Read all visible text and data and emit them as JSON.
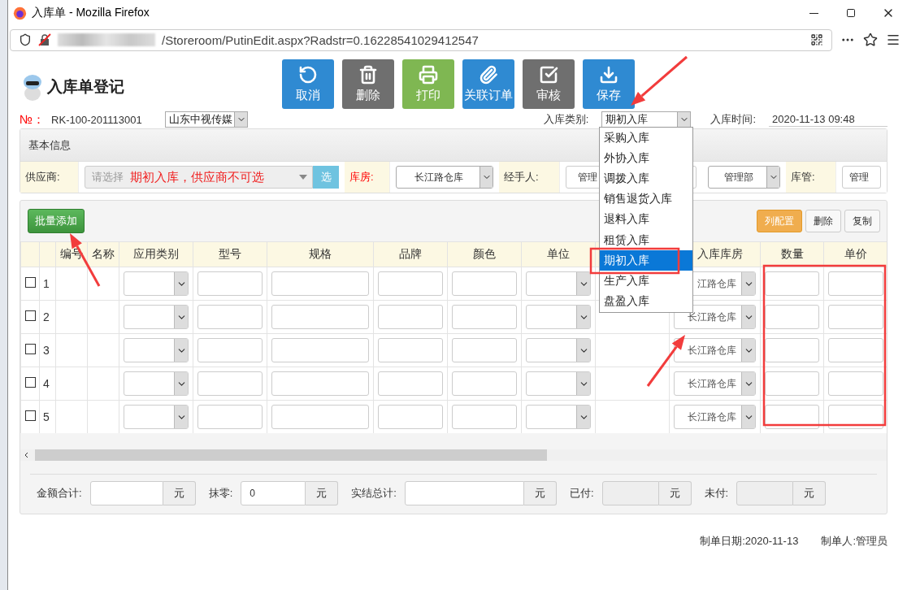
{
  "window": {
    "title": "入库单 - Mozilla Firefox"
  },
  "address_bar": {
    "url": "/Storeroom/PutinEdit.aspx?Radstr=0.16228541029412547"
  },
  "page": {
    "title": "入库单登记"
  },
  "toolbar": [
    {
      "label": "取消",
      "kind": "undo",
      "color": "#2f8ad2"
    },
    {
      "label": "删除",
      "kind": "trash",
      "color": "#6f6f6f"
    },
    {
      "label": "打印",
      "kind": "print",
      "color": "#7fb752"
    },
    {
      "label": "关联订单",
      "kind": "clip",
      "color": "#2f8ad2"
    },
    {
      "label": "审核",
      "kind": "check",
      "color": "#6f6f6f"
    },
    {
      "label": "保存",
      "kind": "download",
      "color": "#2f8ad2"
    }
  ],
  "order": {
    "no_label": "№：",
    "no": "RK-100-201113001",
    "company": "山东中视传媒",
    "type_label": "入库类别:",
    "type_value": "期初入库",
    "time_label": "入库时间:",
    "time_value": "2020-11-13 09:48"
  },
  "type_dropdown": [
    {
      "label": "采购入库",
      "selected": false
    },
    {
      "label": "外协入库",
      "selected": false
    },
    {
      "label": "调拨入库",
      "selected": false
    },
    {
      "label": "销售退货入库",
      "selected": false
    },
    {
      "label": "退料入库",
      "selected": false
    },
    {
      "label": "租赁入库",
      "selected": false
    },
    {
      "label": "期初入库",
      "selected": true
    },
    {
      "label": "生产入库",
      "selected": false
    },
    {
      "label": "盘盈入库",
      "selected": false
    }
  ],
  "basic_info": {
    "title": "基本信息",
    "supplier_label": "供应商:",
    "supplier_placeholder": "请选择",
    "supplier_disabled": true,
    "supplier_note": "期初入库，供应商不可选",
    "pick_button": "选",
    "warehouse_label": "库房:",
    "warehouse": "长江路仓库",
    "handler_label": "经手人:",
    "handler": "管理",
    "department": "管理部",
    "keeper_label": "库管:",
    "keeper": "管理"
  },
  "table_toolbar": {
    "add_button": "批量添加",
    "right_buttons": [
      {
        "label": "列配置",
        "kind": "primary"
      },
      {
        "label": "删除",
        "kind": "default"
      },
      {
        "label": "复制",
        "kind": "default"
      }
    ]
  },
  "table": {
    "columns": [
      {
        "kind": "check"
      },
      {
        "kind": "index"
      },
      {
        "label": "编号",
        "kind": "text"
      },
      {
        "label": "名称",
        "kind": "text"
      },
      {
        "label": "应用类别",
        "kind": "select"
      },
      {
        "label": "型号",
        "kind": "input"
      },
      {
        "label": "规格",
        "kind": "input"
      },
      {
        "label": "品牌",
        "kind": "input"
      },
      {
        "label": "颜色",
        "kind": "input"
      },
      {
        "label": "单位",
        "kind": "select"
      },
      {
        "kind": "blank"
      },
      {
        "label": "入库库房",
        "kind": "warehouse"
      },
      {
        "label": "数量",
        "kind": "input"
      },
      {
        "label": "单价",
        "kind": "input"
      }
    ],
    "rows": [
      {
        "index": "1",
        "checked": false,
        "warehouse": "江路仓库"
      },
      {
        "index": "2",
        "checked": false,
        "warehouse": "长江路仓库"
      },
      {
        "index": "3",
        "checked": false,
        "warehouse": "长江路仓库"
      },
      {
        "index": "4",
        "checked": false,
        "warehouse": "长江路仓库"
      },
      {
        "index": "5",
        "checked": false,
        "warehouse": "长江路仓库"
      }
    ]
  },
  "totals": [
    {
      "label": "金额合计:",
      "disabled": false,
      "unit": "元"
    },
    {
      "label": "抹零:",
      "value": "0",
      "disabled": false,
      "unit": "元"
    },
    {
      "label": "实结总计:",
      "disabled": false,
      "unit": "元"
    },
    {
      "label": "已付:",
      "disabled": true,
      "unit": "元"
    },
    {
      "label": "未付:",
      "disabled": true,
      "unit": "元"
    }
  ],
  "signature": [
    {
      "label": "制单日期:",
      "value": "2020-11-13"
    },
    {
      "label": "制单人:",
      "value": "管理员"
    }
  ],
  "annotations": [
    {
      "kind": "arrow"
    },
    {
      "kind": "arrow"
    },
    {
      "kind": "arrow"
    },
    {
      "kind": "frame"
    },
    {
      "kind": "frame"
    }
  ]
}
